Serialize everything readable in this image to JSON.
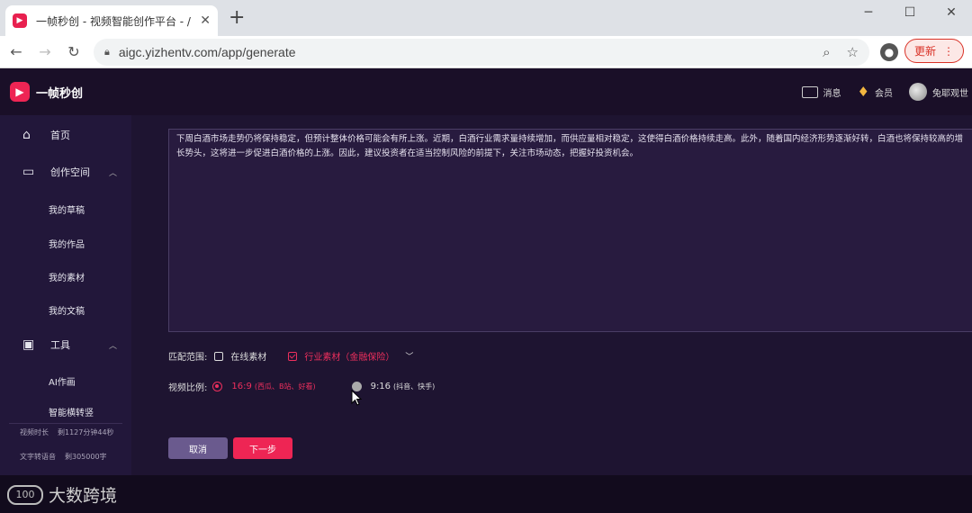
{
  "browser": {
    "tab_title": "一帧秒创 - 视频智能创作平台 - /",
    "url": "aigc.yizhentv.com/app/generate",
    "update_label": "更新"
  },
  "header": {
    "logo_text": "一帧秒创",
    "messages_label": "消息",
    "vip_label": "会员",
    "user_label": "兔耶观世"
  },
  "sidebar": {
    "home": "首页",
    "workspace": "创作空间",
    "drafts": "我的草稿",
    "works": "我的作品",
    "materials": "我的素材",
    "documents": "我的文稿",
    "tools": "工具",
    "ai_painting": "AI作画",
    "smart_convert": "智能横转竖",
    "usage": [
      {
        "label": "视频时长",
        "value": "剩1127分钟44秒"
      },
      {
        "label": "文字转语音",
        "value": "剩305000字"
      }
    ]
  },
  "main": {
    "text_content": "下周白酒市场走势仍将保持稳定，但预计整体价格可能会有所上涨。近期，白酒行业需求量持续增加，而供应量相对稳定，这使得白酒价格持续走高。此外，随着国内经济形势逐渐好转，白酒也将保持较高的增长势头，这将进一步促进白酒价格的上涨。因此，建议投资者在适当控制风险的前提下，关注市场动态，把握好投资机会。",
    "match_label": "匹配范围:",
    "online_material": "在线素材",
    "industry_material": "行业素材（金融保险）",
    "ratio_label": "视频比例:",
    "ratio_169": "16:9",
    "ratio_169_hint": "(西瓜、B站、好看)",
    "ratio_916": "9:16",
    "ratio_916_hint": "(抖音、快手)",
    "cancel": "取消",
    "next": "下一步"
  },
  "watermark": "大数跨境",
  "colors": {
    "accent": "#ee2554",
    "sidebar": "#22173a",
    "main": "#1e1431"
  }
}
